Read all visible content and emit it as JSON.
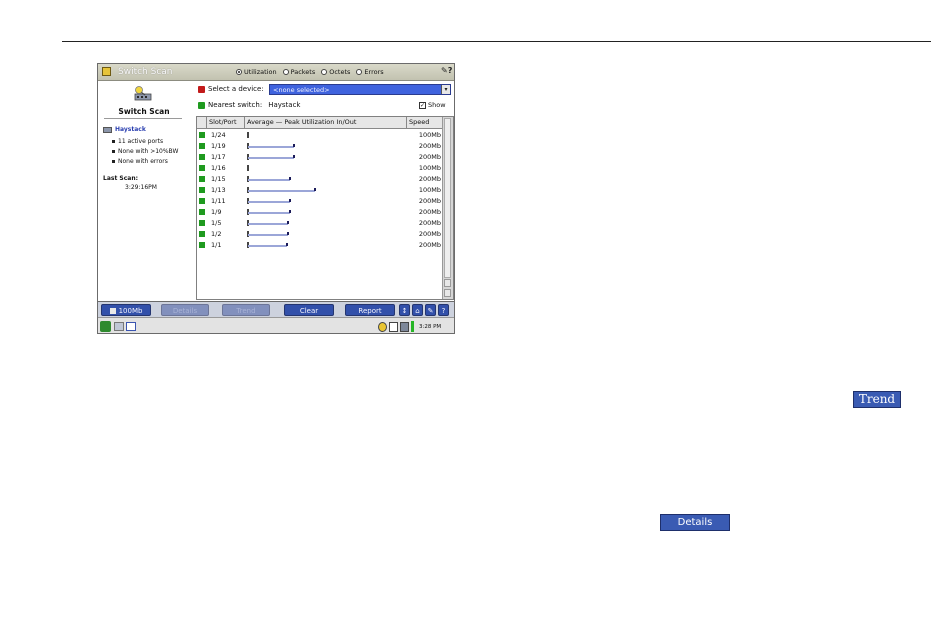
{
  "window": {
    "title": "Switch Scan"
  },
  "modes": [
    {
      "label": "Utilization",
      "selected": true
    },
    {
      "label": "Packets",
      "selected": false
    },
    {
      "label": "Octets",
      "selected": false
    },
    {
      "label": "Errors",
      "selected": false
    }
  ],
  "help_glyph": "✎?",
  "left_pane": {
    "icon": "switch-scan-icon",
    "label": "Switch Scan",
    "switch_name": "Haystack",
    "stats": [
      "11 active ports",
      "None with >10%BW",
      "None with errors"
    ],
    "last_scan_label": "Last Scan:",
    "last_scan_time": "3:29:16PM"
  },
  "device_select": {
    "label": "Select a device:",
    "value": "<none selected>",
    "status_color": "#c21a1a"
  },
  "nearest": {
    "label": "Nearest switch:",
    "value": "Haystack",
    "show_label": "Show",
    "show_checked": true,
    "status_color": "#1f9a1f"
  },
  "table": {
    "headers": [
      "Slot/Port",
      "Average — Peak Utilization In/Out",
      "Speed"
    ],
    "rows": [
      {
        "port": "1/24",
        "util": 0.0,
        "speed": "100Mb"
      },
      {
        "port": "1/19",
        "util": 0.65,
        "speed": "200Mb"
      },
      {
        "port": "1/17",
        "util": 0.65,
        "speed": "200Mb"
      },
      {
        "port": "1/16",
        "util": 0.0,
        "speed": "100Mb"
      },
      {
        "port": "1/15",
        "util": 0.6,
        "speed": "200Mb"
      },
      {
        "port": "1/13",
        "util": 0.95,
        "speed": "100Mb"
      },
      {
        "port": "1/11",
        "util": 0.6,
        "speed": "200Mb"
      },
      {
        "port": "1/9",
        "util": 0.6,
        "speed": "200Mb"
      },
      {
        "port": "1/5",
        "util": 0.57,
        "speed": "200Mb"
      },
      {
        "port": "1/2",
        "util": 0.57,
        "speed": "200Mb"
      },
      {
        "port": "1/1",
        "util": 0.55,
        "speed": "200Mb"
      }
    ]
  },
  "buttons": {
    "speed": "100Mb",
    "details_disabled": "Details",
    "trend_disabled": "Trend",
    "clear": "Clear",
    "report": "Report",
    "small": [
      "↕",
      "⌂",
      "✎",
      "?"
    ]
  },
  "status_bar": {
    "time": "3:28 PM"
  },
  "page_buttons": {
    "trend": "Trend",
    "details": "Details"
  }
}
